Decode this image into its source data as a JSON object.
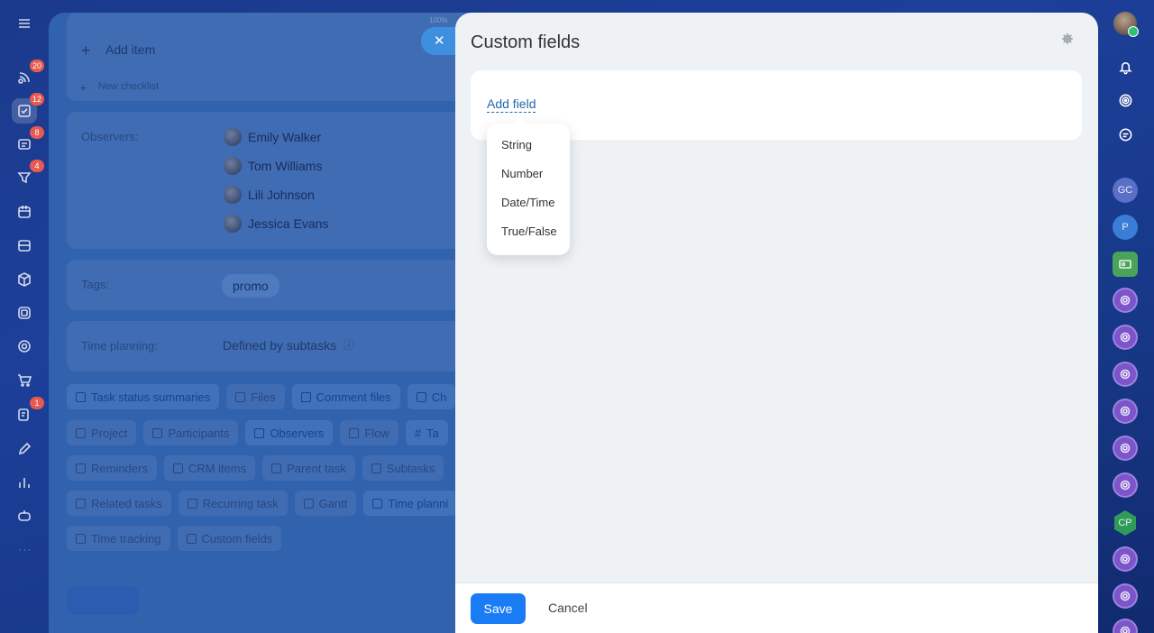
{
  "left_rail": {
    "badges": {
      "feed": "20",
      "tasks": "12",
      "chat": "8",
      "crm": "4",
      "sign": "1"
    }
  },
  "background_task": {
    "zoom": "100%",
    "add_item": "Add item",
    "new_checklist": "New checklist",
    "observers_label": "Observers:",
    "observers": [
      "Emily Walker",
      "Tom Williams",
      "Lili Johnson",
      "Jessica Evans"
    ],
    "tags_label": "Tags:",
    "tag": "promo",
    "time_planning_label": "Time planning:",
    "time_planning_value": "Defined by subtasks",
    "chips_row1": [
      "Task status summaries",
      "Files",
      "Comment files",
      "Ch"
    ],
    "chips_row2": [
      "Project",
      "Participants",
      "Observers",
      "Flow",
      "Ta"
    ],
    "chips_row3": [
      "Reminders",
      "CRM items",
      "Parent task",
      "Subtasks"
    ],
    "chips_row4": [
      "Related tasks",
      "Recurring task",
      "Gantt",
      "Time planni"
    ],
    "chips_row5": [
      "Time tracking",
      "Custom fields"
    ]
  },
  "close_bubble": {
    "glyph": "✕"
  },
  "panel": {
    "title": "Custom fields",
    "add_field_link": "Add field",
    "field_types": [
      "String",
      "Number",
      "Date/Time",
      "True/False"
    ],
    "footer": {
      "save_label": "Save",
      "cancel_label": "Cancel"
    }
  },
  "right_rail": {
    "chats": [
      "GC",
      "P",
      "CP"
    ]
  },
  "colors": {
    "accent": "#1a7cf5",
    "link": "#2067b0",
    "panel_bg": "#eef2f4",
    "badge": "#e85a4f"
  }
}
